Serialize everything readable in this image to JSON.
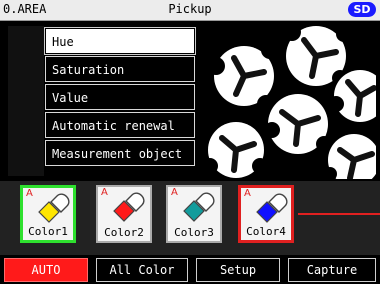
{
  "header": {
    "area": "0.AREA",
    "title": "Pickup",
    "badge": "SD"
  },
  "menu": {
    "items": [
      {
        "label": "Hue",
        "selected": true
      },
      {
        "label": "Saturation",
        "selected": false
      },
      {
        "label": "Value",
        "selected": false
      },
      {
        "label": "Automatic renewal",
        "selected": false
      },
      {
        "label": "Measurement object",
        "selected": false
      }
    ]
  },
  "colors": {
    "tiles": [
      {
        "label": "Color1",
        "marker": "A",
        "swatch": "#ffe600",
        "border": "#2ee02e"
      },
      {
        "label": "Color2",
        "marker": "A",
        "swatch": "#ff1a1a",
        "border": "#aaaaaa"
      },
      {
        "label": "Color3",
        "marker": "A",
        "swatch": "#129c9c",
        "border": "#aaaaaa"
      },
      {
        "label": "Color4",
        "marker": "A",
        "swatch": "#1010ff",
        "border": "#e02020"
      }
    ]
  },
  "buttons": [
    {
      "label": "AUTO",
      "active": true
    },
    {
      "label": "All Color",
      "active": false
    },
    {
      "label": "Setup",
      "active": false
    },
    {
      "label": "Capture",
      "active": false
    }
  ]
}
